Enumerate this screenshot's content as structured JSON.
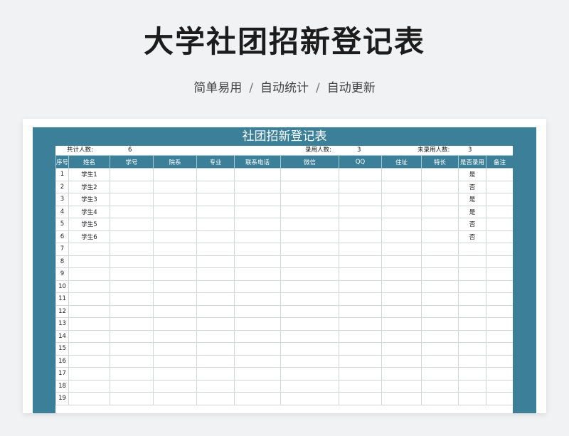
{
  "title": "大学社团招新登记表",
  "subtitle": {
    "items": [
      "简单易用",
      "自动统计",
      "自动更新"
    ],
    "separator": "/"
  },
  "sheet": {
    "title": "社团招新登记表",
    "summary": {
      "total_label": "共计人数:",
      "total_value": "6",
      "admitted_label": "录用人数:",
      "admitted_value": "3",
      "not_admitted_label": "未录用人数:",
      "not_admitted_value": "3"
    },
    "columns": [
      "序号",
      "姓名",
      "学号",
      "院系",
      "专业",
      "联系电话",
      "微信",
      "QQ",
      "住址",
      "特长",
      "是否录用",
      "备注"
    ],
    "rows": [
      [
        "1",
        "学生1",
        "",
        "",
        "",
        "",
        "",
        "",
        "",
        "",
        "是",
        ""
      ],
      [
        "2",
        "学生2",
        "",
        "",
        "",
        "",
        "",
        "",
        "",
        "",
        "否",
        ""
      ],
      [
        "3",
        "学生3",
        "",
        "",
        "",
        "",
        "",
        "",
        "",
        "",
        "是",
        ""
      ],
      [
        "4",
        "学生4",
        "",
        "",
        "",
        "",
        "",
        "",
        "",
        "",
        "是",
        ""
      ],
      [
        "5",
        "学生5",
        "",
        "",
        "",
        "",
        "",
        "",
        "",
        "",
        "否",
        ""
      ],
      [
        "6",
        "学生6",
        "",
        "",
        "",
        "",
        "",
        "",
        "",
        "",
        "否",
        ""
      ],
      [
        "7",
        "",
        "",
        "",
        "",
        "",
        "",
        "",
        "",
        "",
        "",
        ""
      ],
      [
        "8",
        "",
        "",
        "",
        "",
        "",
        "",
        "",
        "",
        "",
        "",
        ""
      ],
      [
        "9",
        "",
        "",
        "",
        "",
        "",
        "",
        "",
        "",
        "",
        "",
        ""
      ],
      [
        "10",
        "",
        "",
        "",
        "",
        "",
        "",
        "",
        "",
        "",
        "",
        ""
      ],
      [
        "11",
        "",
        "",
        "",
        "",
        "",
        "",
        "",
        "",
        "",
        "",
        ""
      ],
      [
        "12",
        "",
        "",
        "",
        "",
        "",
        "",
        "",
        "",
        "",
        "",
        ""
      ],
      [
        "13",
        "",
        "",
        "",
        "",
        "",
        "",
        "",
        "",
        "",
        "",
        ""
      ],
      [
        "14",
        "",
        "",
        "",
        "",
        "",
        "",
        "",
        "",
        "",
        "",
        ""
      ],
      [
        "15",
        "",
        "",
        "",
        "",
        "",
        "",
        "",
        "",
        "",
        "",
        ""
      ],
      [
        "16",
        "",
        "",
        "",
        "",
        "",
        "",
        "",
        "",
        "",
        "",
        ""
      ],
      [
        "17",
        "",
        "",
        "",
        "",
        "",
        "",
        "",
        "",
        "",
        "",
        ""
      ],
      [
        "18",
        "",
        "",
        "",
        "",
        "",
        "",
        "",
        "",
        "",
        "",
        ""
      ],
      [
        "19",
        "",
        "",
        "",
        "",
        "",
        "",
        "",
        "",
        "",
        "",
        ""
      ]
    ]
  },
  "colors": {
    "header": "#3b7f99",
    "background": "#f1f2f4"
  }
}
